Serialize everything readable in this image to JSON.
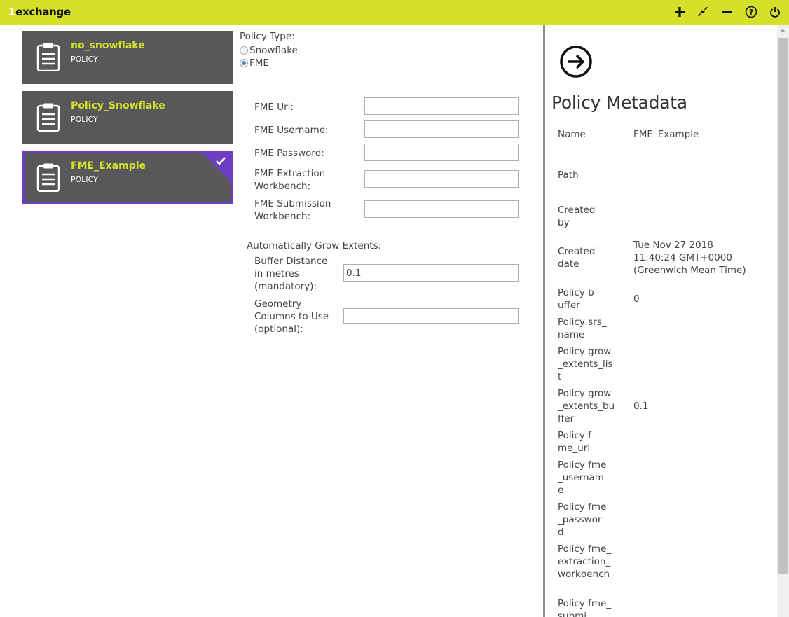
{
  "app": {
    "logo_prefix": "1",
    "logo_text": "exchange",
    "accent_color": "#d4e02a",
    "selected_border_color": "#6b3fbf"
  },
  "toolbar": {
    "actions": [
      "add-icon",
      "import-icon",
      "remove-icon",
      "help-icon",
      "power-icon"
    ]
  },
  "policies": [
    {
      "title": "no_snowflake",
      "type": "POLICY",
      "selected": false
    },
    {
      "title": "Policy_Snowflake",
      "type": "POLICY",
      "selected": false
    },
    {
      "title": "FME_Example",
      "type": "POLICY",
      "selected": true
    }
  ],
  "form": {
    "policy_type_label": "Policy Type:",
    "options": [
      {
        "label": "Snowflake",
        "checked": false
      },
      {
        "label": "FME",
        "checked": true
      }
    ],
    "fme_url_label": "FME Url:",
    "fme_url_value": "",
    "fme_username_label": "FME Username:",
    "fme_username_value": "",
    "fme_password_label": "FME Password:",
    "fme_password_value": "",
    "fme_extraction_label": "FME Extraction Workbench:",
    "fme_extraction_value": "",
    "fme_submission_label": "FME Submission Workbench:",
    "fme_submission_value": "",
    "grow_extents_label": "Automatically Grow Extents:",
    "buffer_label": "Buffer Distance in metres (mandatory):",
    "buffer_value": "0.1",
    "geometry_label": "Geometry Columns to Use (optional):",
    "geometry_value": ""
  },
  "metadata": {
    "title": "Policy Metadata",
    "rows": [
      {
        "key": "Name",
        "value": "FME_Example"
      },
      {
        "key": "Path",
        "value": ""
      },
      {
        "key": "Created by",
        "value": ""
      },
      {
        "key": "Created date",
        "value": "Tue Nov 27 2018 11:40:24 GMT+0000 (Greenwich Mean Time)"
      },
      {
        "key": "Policy buffer",
        "value": "0"
      },
      {
        "key": "Policy srs_name",
        "value": ""
      },
      {
        "key": "Policy grow_extents_list",
        "value": ""
      },
      {
        "key": "Policy grow_extents_buffer",
        "value": "0.1"
      },
      {
        "key": "Policy fme_url",
        "value": ""
      },
      {
        "key": "Policy fme_username",
        "value": ""
      },
      {
        "key": "Policy fme_password",
        "value": ""
      },
      {
        "key": "Policy fme_extraction_workbench",
        "value": ""
      },
      {
        "key": "Policy fme_submi",
        "value": ""
      }
    ]
  }
}
